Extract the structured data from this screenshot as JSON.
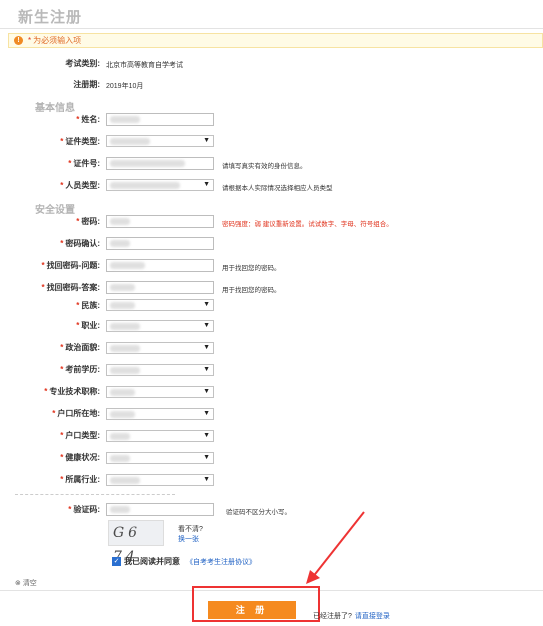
{
  "page_title": "新生注册",
  "notice": {
    "icon": "warning-icon",
    "required_mark": "*",
    "text": "为必须输入项"
  },
  "exam_category": {
    "label": "考试类别:",
    "value": "北京市高等教育自学考试"
  },
  "registration_period": {
    "label": "注册期:",
    "value": "2019年10月"
  },
  "sections": {
    "basic": "基本信息",
    "security": "安全设置"
  },
  "fields": {
    "name": {
      "label": "姓名:"
    },
    "id_type": {
      "label": "证件类型:"
    },
    "id_number": {
      "label": "证件号:",
      "hint": "请填写真实有效的身份信息。"
    },
    "person_type": {
      "label": "人员类型:",
      "hint": "请根据本人实际情况选择相应人员类型"
    },
    "password": {
      "label": "密码:",
      "hint": "密码强度：弱 建议重新设置。试试数字、字母、符号组合。"
    },
    "confirm_password": {
      "label": "密码确认:"
    },
    "recovery_question": {
      "label": "找回密码-问题:",
      "hint": "用于找回您的密码。"
    },
    "recovery_answer": {
      "label": "找回密码-答案:",
      "hint": "用于找回您的密码。"
    },
    "ethnicity": {
      "label": "民族:"
    },
    "occupation": {
      "label": "职业:"
    },
    "political_status": {
      "label": "政治面貌:"
    },
    "education": {
      "label": "考前学历:"
    },
    "professional_title": {
      "label": "专业技术职称:"
    },
    "hukou_location": {
      "label": "户口所在地:"
    },
    "hukou_type": {
      "label": "户口类型:"
    },
    "health": {
      "label": "健康状况:"
    },
    "industry": {
      "label": "所属行业:"
    },
    "captcha": {
      "label": "验证码:",
      "hint": "验证码不区分大小写。"
    }
  },
  "captcha_image_text": "G6 74",
  "captcha_unclear": "看不清?",
  "captcha_refresh": "换一张",
  "agree": {
    "checked": true,
    "label": "我已阅读并同意",
    "link": "《自考考生注册协议》"
  },
  "clear_label": "清空",
  "submit_label": "注 册",
  "already_registered": "已经注册了?",
  "login_link": "请直接登录"
}
